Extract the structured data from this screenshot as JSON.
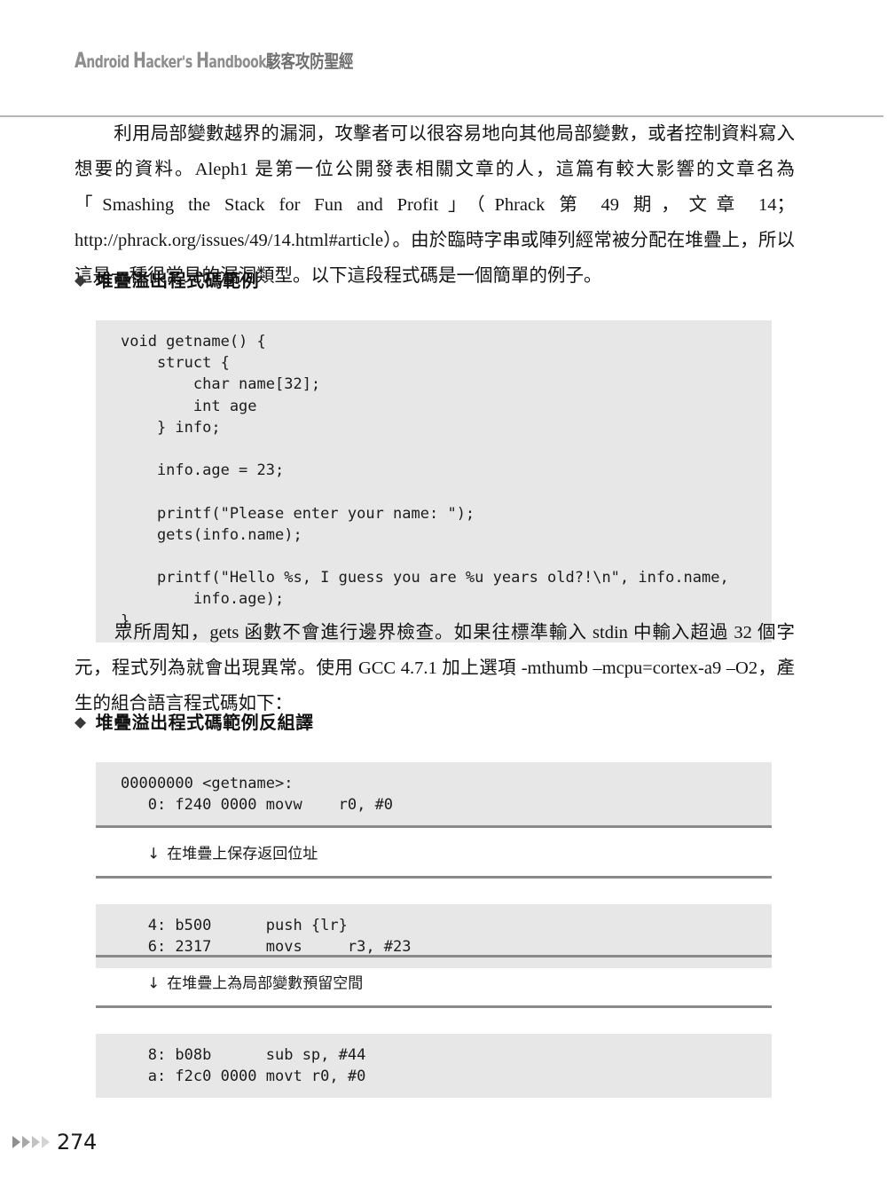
{
  "header": {
    "title_latin_parts": [
      "A",
      "ndroid ",
      "H",
      "acker's ",
      "H",
      "andbook"
    ],
    "title_latin": "Android Hacker's Handbook",
    "title_cjk": "駭客攻防聖經",
    "title_full": "Android Hacker's Handbook駭客攻防聖經"
  },
  "paragraphs": {
    "p1": "利用局部變數越界的漏洞，攻擊者可以很容易地向其他局部變數，或者控制資料寫入想要的資料。Aleph1 是第一位公開發表相關文章的人，這篇有較大影響的文章名為「Smashing the Stack for Fun and Profit」（Phrack 第 49 期，文章 14；http://phrack.org/issues/49/14.html#article）。由於臨時字串或陣列經常被分配在堆疊上，所以這是一種很常見的漏洞類型。以下這段程式碼是一個簡單的例子。",
    "p2": "眾所周知，gets 函數不會進行邊界檢查。如果往標準輸入 stdin 中輸入超過 32 個字元，程式列為就會出現異常。使用 GCC 4.7.1 加上選項 -mthumb –mcpu=cortex-a9 –O2，產生的組合語言程式碼如下："
  },
  "headings": {
    "bullet": "◆",
    "h1": "堆疊溢出程式碼範例",
    "h2": "堆疊溢出程式碼範例反組譯"
  },
  "code_blocks": {
    "c_source": "void getname() {\n    struct {\n        char name[32];\n        int age\n    } info;\n\n    info.age = 23;\n\n    printf(\"Please enter your name: \");\n    gets(info.name);\n\n    printf(\"Hello %s, I guess you are %u years old?!\\n\", info.name,\n        info.age);\n}",
    "asm_1": "00000000 <getname>:\n   0: f240 0000 movw    r0, #0",
    "asm_2": "   4: b500      push {lr}\n   6: 2317      movs     r3, #23",
    "asm_3": "   8: b08b      sub sp, #44\n   a: f2c0 0000 movt r0, #0"
  },
  "annotations": {
    "arrow": "↓",
    "a1": "在堆疊上保存返回位址",
    "a2": "在堆疊上為局部變數預留空間"
  },
  "footer": {
    "page_number": "274",
    "marker_count": 4
  },
  "colors": {
    "code_background": "#e7e7e7",
    "rule": "#8a8a8a",
    "header_rule": "#b6b6b6",
    "header_text": "#8d8d8d",
    "body_text": "#141414"
  }
}
